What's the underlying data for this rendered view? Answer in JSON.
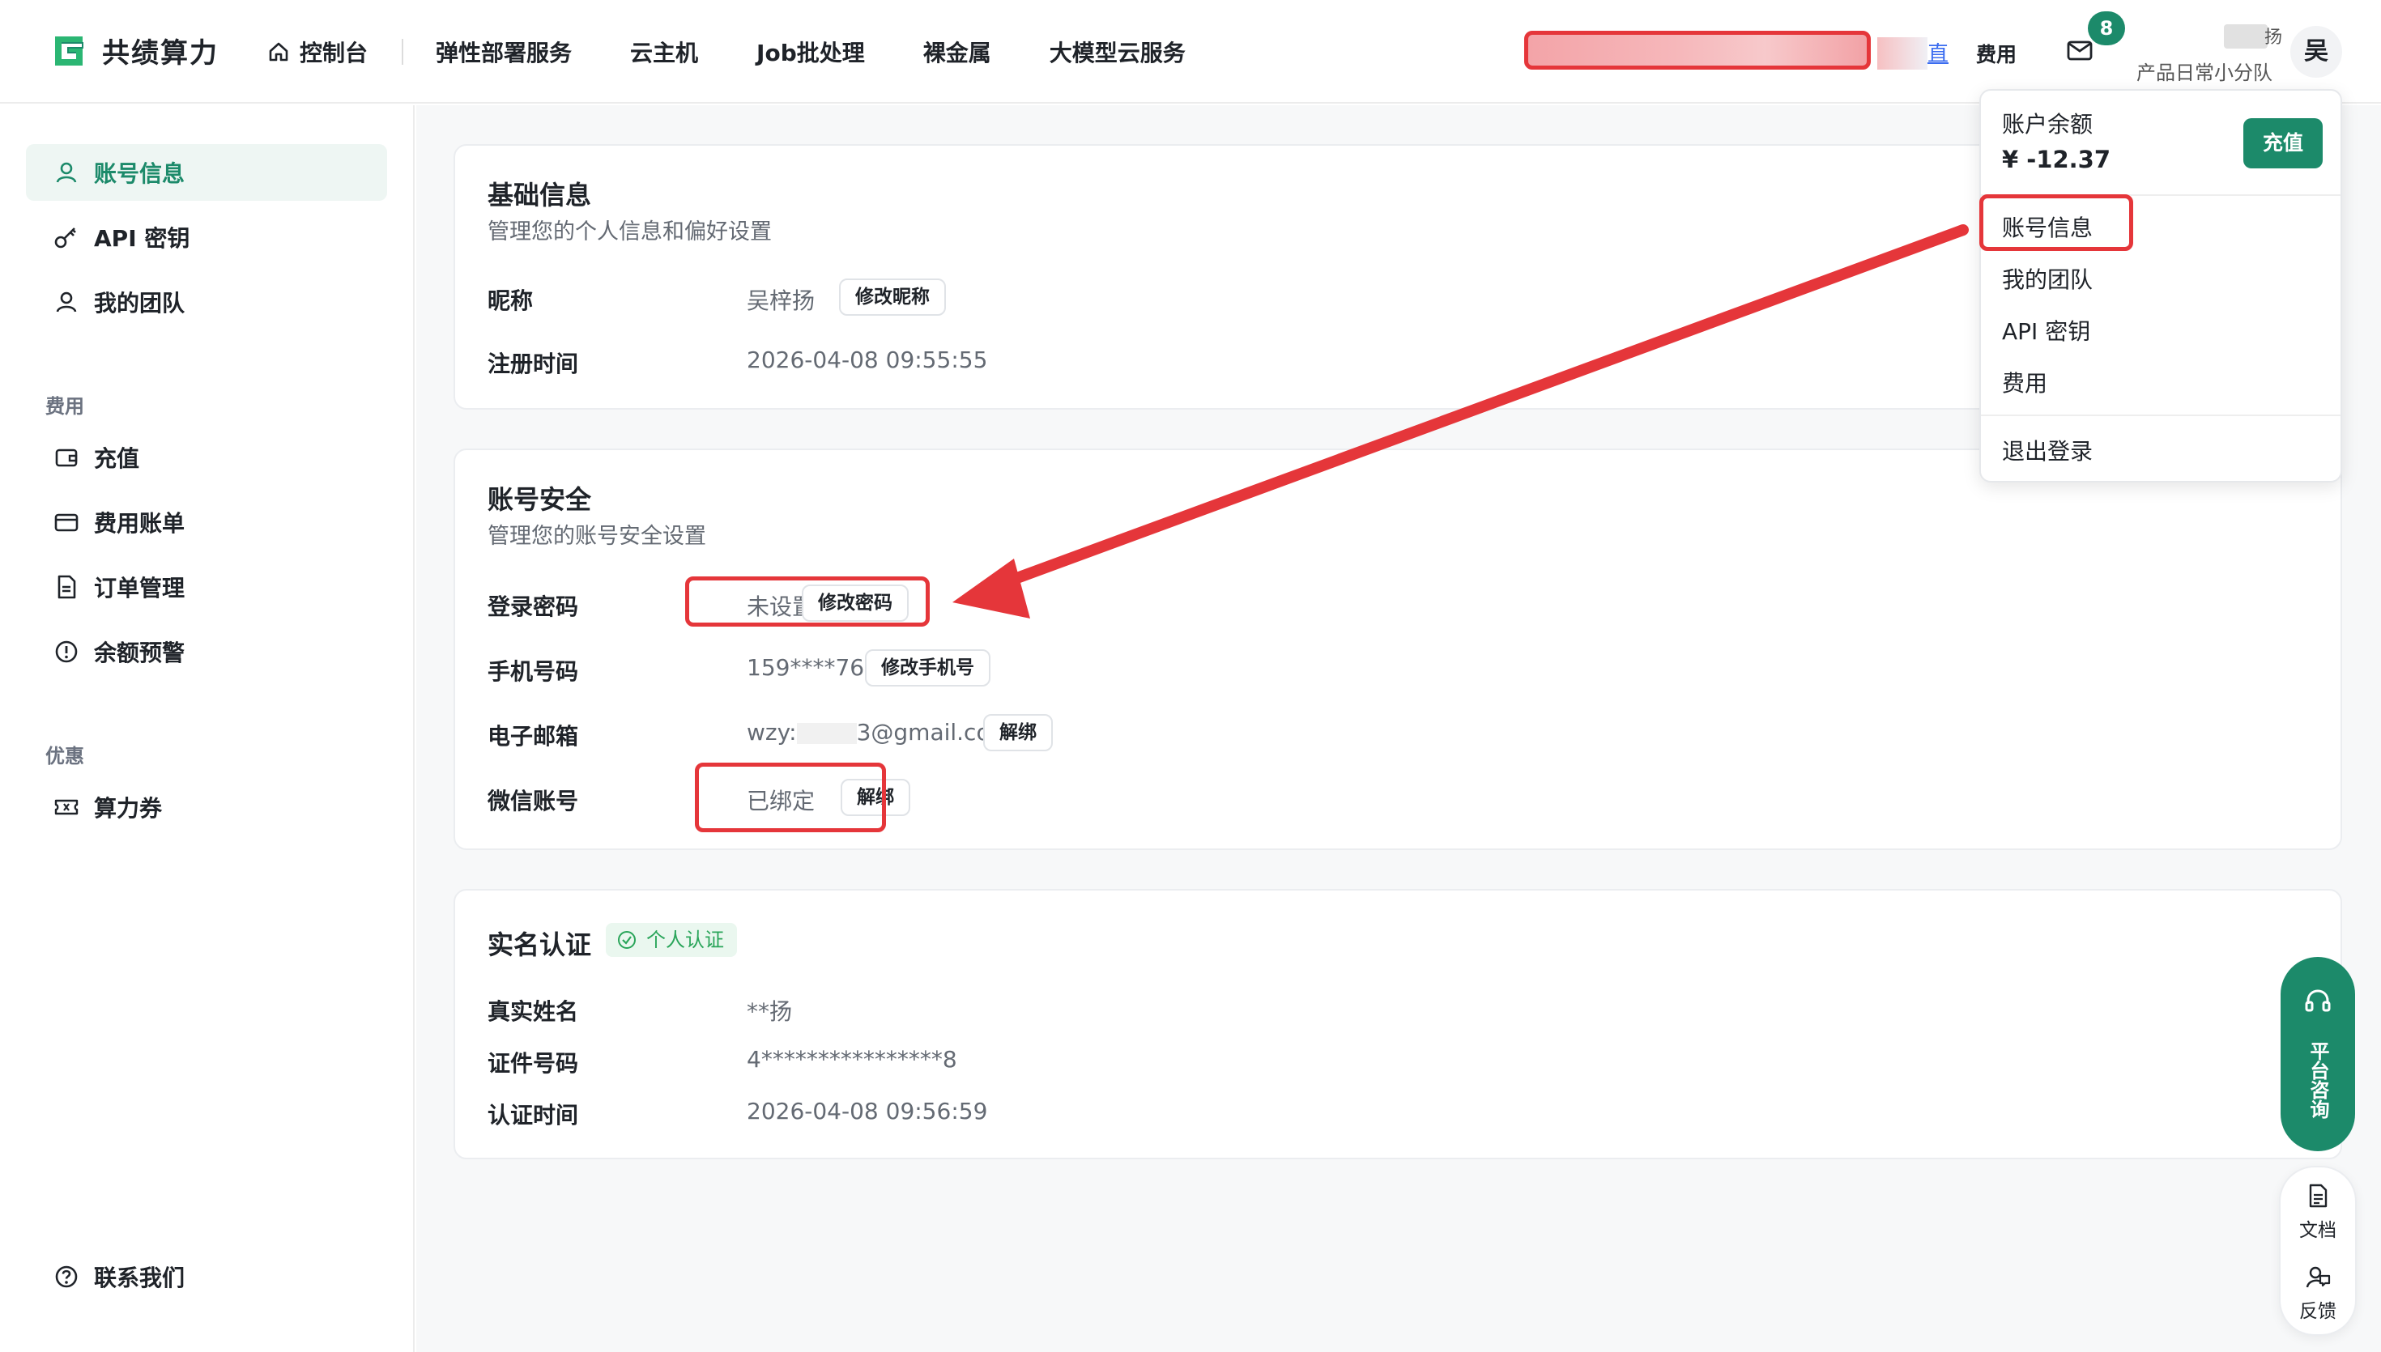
{
  "app": {
    "logo_text": "共绩算力"
  },
  "nav": {
    "items": [
      "控制台",
      "弹性部署服务",
      "云主机",
      "Job批处理",
      "裸金属",
      "大模型云服务"
    ]
  },
  "header": {
    "blue_char": "直",
    "fee_label": "费用",
    "mail_badge": "8",
    "user_last_char": "扬",
    "team_name": "产品日常小分队",
    "avatar_char": "吴"
  },
  "sidebar": {
    "items_top": [
      "账号信息",
      "API 密钥",
      "我的团队"
    ],
    "group_fee": "费用",
    "items_fee": [
      "充值",
      "费用账单",
      "订单管理",
      "余额预警"
    ],
    "group_promo": "优惠",
    "items_promo": [
      "算力券"
    ],
    "contact": "联系我们"
  },
  "basic": {
    "title": "基础信息",
    "subtitle": "管理您的个人信息和偏好设置",
    "nickname_label": "昵称",
    "nickname_value": "吴梓扬",
    "nickname_btn": "修改昵称",
    "reg_label": "注册时间",
    "reg_value": "2026-04-08 09:55:55"
  },
  "security": {
    "title": "账号安全",
    "subtitle": "管理您的账号安全设置",
    "password_label": "登录密码",
    "password_value": "未设置",
    "password_btn": "修改密码",
    "phone_label": "手机号码",
    "phone_value": "159****7670",
    "phone_btn": "修改手机号",
    "email_label": "电子邮箱",
    "email_prefix": "wzy:",
    "email_suffix": "3@gmail.com",
    "email_btn": "解绑",
    "wechat_label": "微信账号",
    "wechat_value": "已绑定",
    "wechat_btn": "解绑"
  },
  "realname": {
    "title": "实名认证",
    "tag": "个人认证",
    "name_label": "真实姓名",
    "name_value": "**扬",
    "id_label": "证件号码",
    "id_value": "4****************8",
    "time_label": "认证时间",
    "time_value": "2026-04-08 09:56:59"
  },
  "dropdown": {
    "balance_label": "账户余额",
    "balance_value": "¥ -12.37",
    "recharge_btn": "充值",
    "items": [
      "账号信息",
      "我的团队",
      "API 密钥",
      "费用"
    ],
    "logout": "退出登录"
  },
  "float": {
    "consult": "平台咨询",
    "docs": "文档",
    "feedback": "反馈"
  },
  "colors": {
    "brand": "#1c8a6a",
    "annotation": "#e5363a"
  }
}
